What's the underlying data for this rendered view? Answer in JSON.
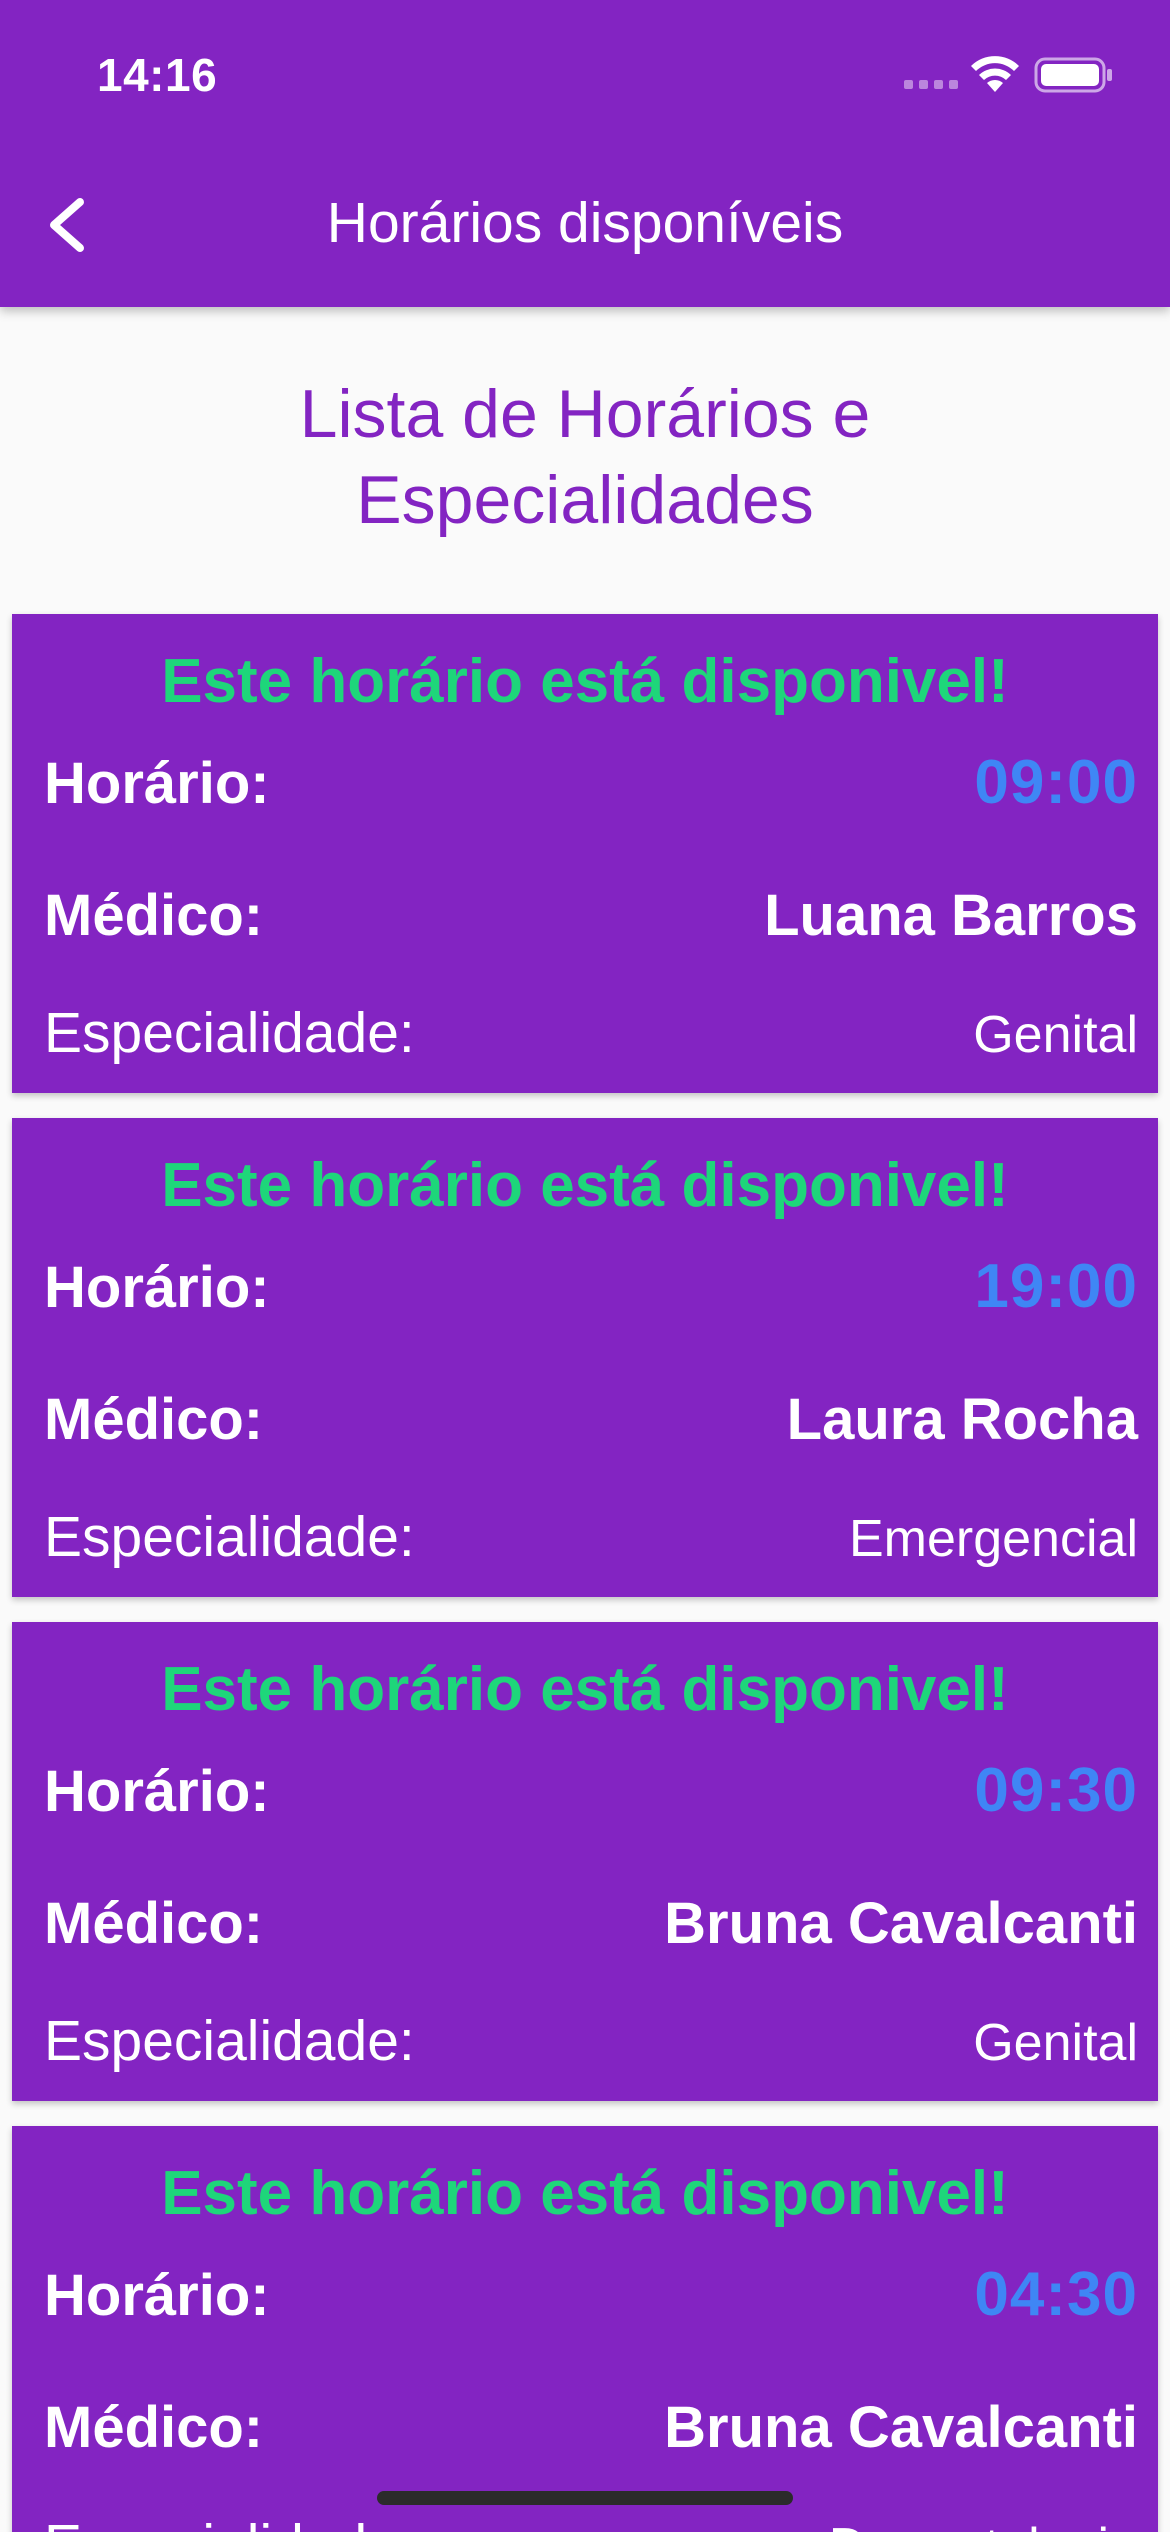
{
  "status_bar": {
    "time": "14:16"
  },
  "app_bar": {
    "title": "Horários disponíveis",
    "back_icon": "chevron-left-icon"
  },
  "page": {
    "heading": "Lista de Horários e Especialidades"
  },
  "labels": {
    "time": "Horário:",
    "doctor": "Médico:",
    "specialty": "Especialidade:"
  },
  "cards": [
    {
      "status": "Este horário está disponivel!",
      "time": "09:00",
      "doctor": "Luana Barros",
      "specialty": "Genital"
    },
    {
      "status": "Este horário está disponivel!",
      "time": "19:00",
      "doctor": "Laura Rocha",
      "specialty": "Emergencial"
    },
    {
      "status": "Este horário está disponivel!",
      "time": "09:30",
      "doctor": "Bruna Cavalcanti",
      "specialty": "Genital"
    },
    {
      "status": "Este horário está disponivel!",
      "time": "04:30",
      "doctor": "Bruna Cavalcanti",
      "specialty": "Dermatologia"
    }
  ],
  "colors": {
    "primary": "#8324c2",
    "available_status": "#1ed67a",
    "time_value": "#3f86f5",
    "background": "#fafafa"
  }
}
